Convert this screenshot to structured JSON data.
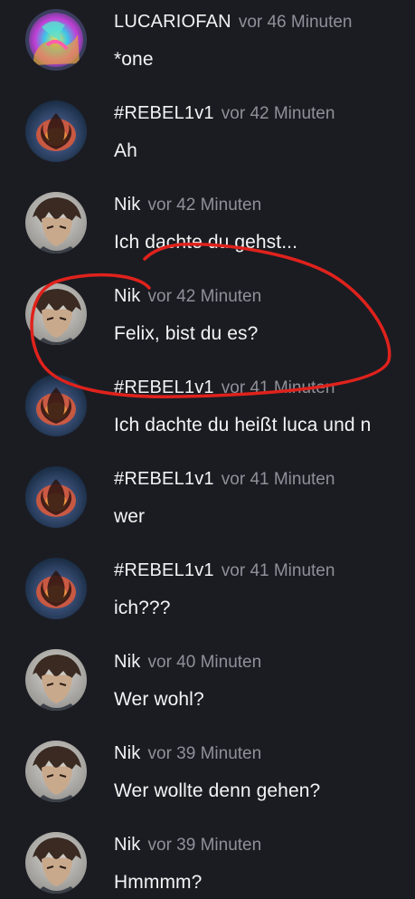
{
  "colors": {
    "background": "#1b1c22",
    "author_text": "#f3f3f5",
    "timestamp_text": "#8f9099",
    "annotation_stroke": "#e0221c"
  },
  "messages": [
    {
      "author": "LUCARIOFAN",
      "time": "vor 46 Minuten",
      "text": "*one",
      "avatar": "lucario-avatar"
    },
    {
      "author": "#REBEL1v1",
      "time": "vor 42 Minuten",
      "text": "Ah",
      "avatar": "rebel-avatar"
    },
    {
      "author": "Nik",
      "time": "vor 42 Minuten",
      "text": "Ich dachte du gehst...",
      "avatar": "nik-avatar"
    },
    {
      "author": "Nik",
      "time": "vor 42 Minuten",
      "text": "Felix, bist du es?",
      "avatar": "nik-avatar"
    },
    {
      "author": "#REBEL1v1",
      "time": "vor 41 Minuten",
      "text": "Ich dachte du heißt luca und n",
      "avatar": "rebel-avatar"
    },
    {
      "author": "#REBEL1v1",
      "time": "vor 41 Minuten",
      "text": "wer",
      "avatar": "rebel-avatar"
    },
    {
      "author": "#REBEL1v1",
      "time": "vor 41 Minuten",
      "text": "ich???",
      "avatar": "rebel-avatar"
    },
    {
      "author": "Nik",
      "time": "vor 40 Minuten",
      "text": "Wer wohl?",
      "avatar": "nik-avatar"
    },
    {
      "author": "Nik",
      "time": "vor 39 Minuten",
      "text": "Wer wollte denn gehen?",
      "avatar": "nik-avatar"
    },
    {
      "author": "Nik",
      "time": "vor 39 Minuten",
      "text": "Hmmmm?",
      "avatar": "nik-avatar"
    }
  ]
}
